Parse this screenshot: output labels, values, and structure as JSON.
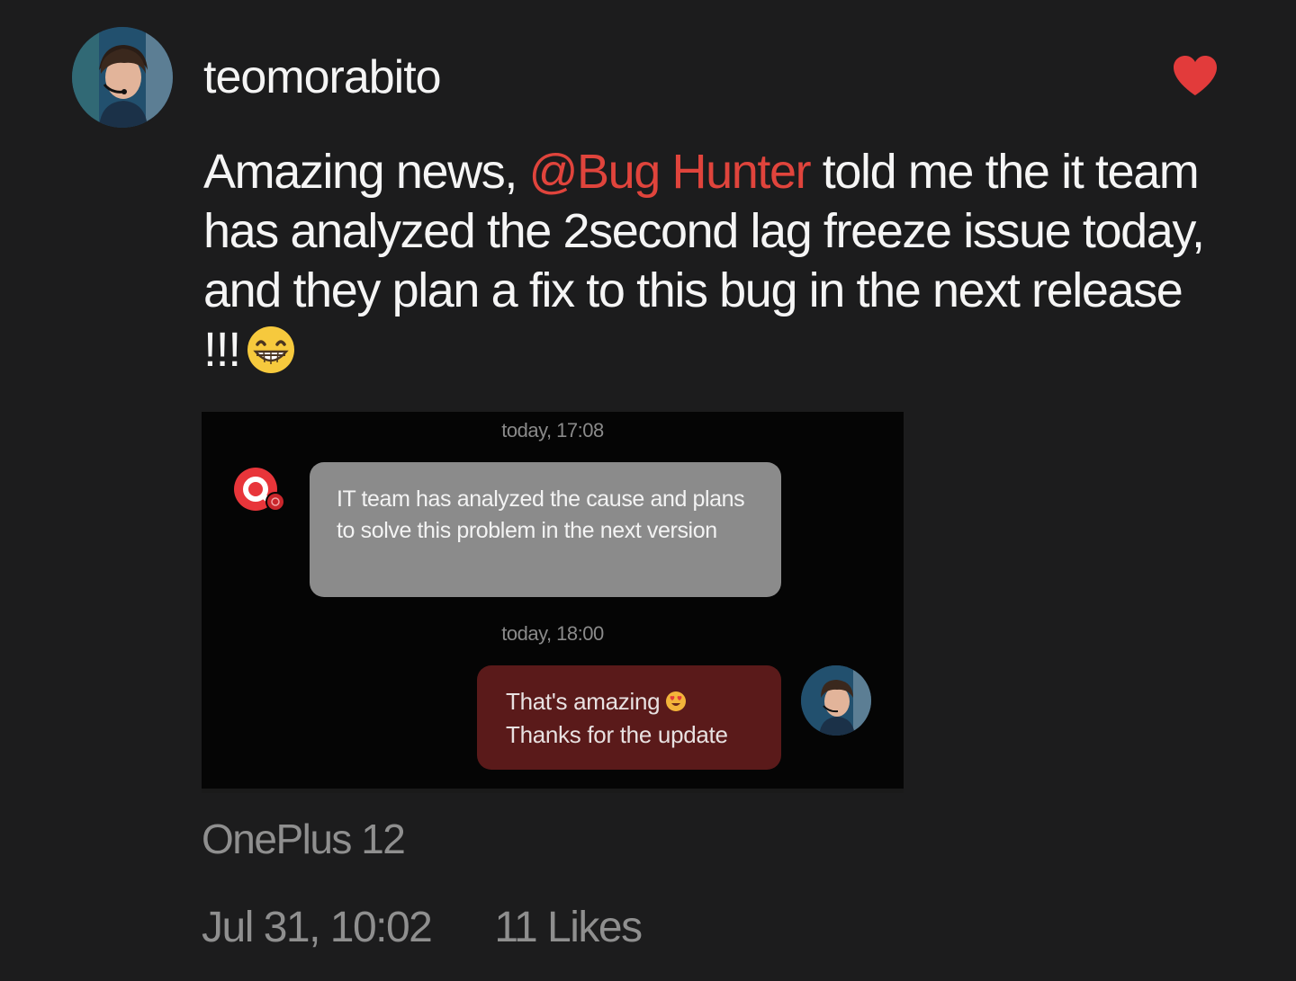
{
  "post": {
    "username": "teomorabito",
    "text_before": "Amazing news, ",
    "mention": "@Bug Hunter",
    "text_after": " told me the it team has analyzed the 2second lag freeze issue today, and they plan a fix to this bug in the next release !!!",
    "emoji_icon": "grinning-face-icon",
    "liked": true,
    "like_color": "#e23b3b",
    "mention_color": "#e0443c",
    "device": "OnePlus 12",
    "timestamp": "Jul 31, 10:02",
    "likes": "11 Likes"
  },
  "attachment": {
    "timestamp_1": "today, 17:08",
    "incoming_message": "IT team has analyzed the cause and plans to solve this problem in the next version",
    "timestamp_2": "today, 18:00",
    "outgoing_line_1": "That's amazing",
    "outgoing_line_2": "Thanks for the update",
    "outgoing_emoji_icon": "heart-eyes-icon",
    "incoming_bubble_color": "#8b8b8b",
    "outgoing_bubble_color": "#5a1a1a"
  }
}
